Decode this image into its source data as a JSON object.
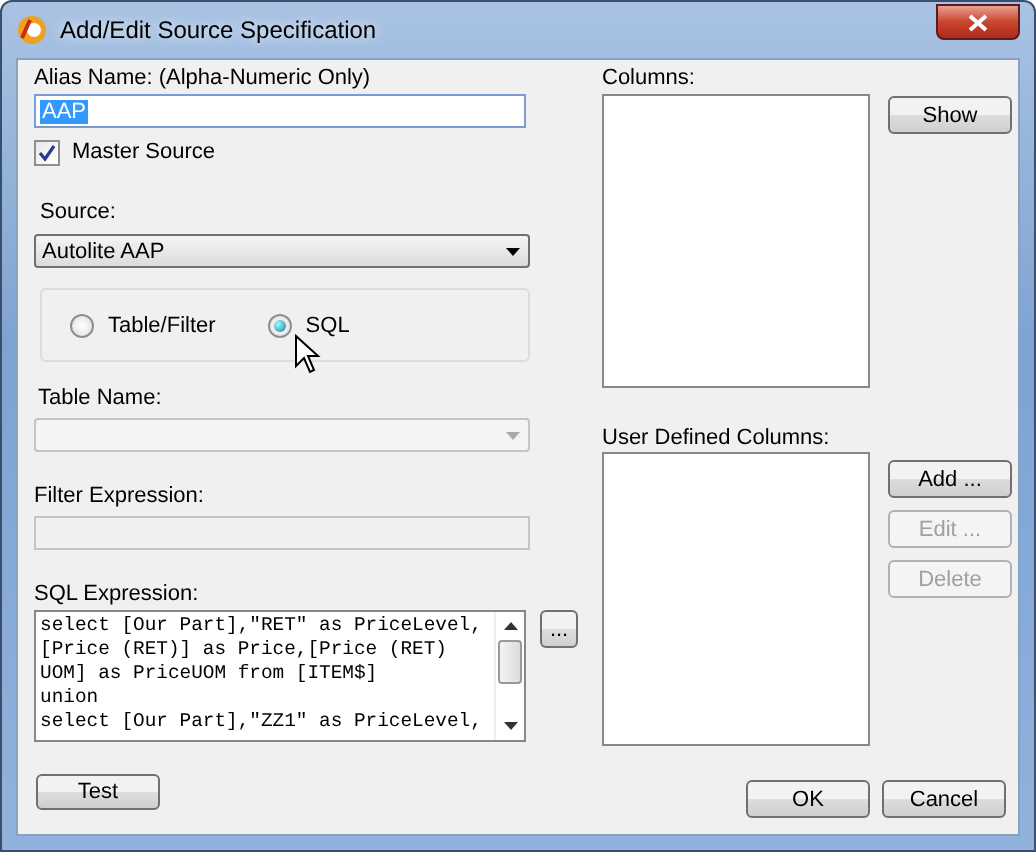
{
  "window": {
    "title": "Add/Edit Source Specification"
  },
  "alias": {
    "label": "Alias Name:  (Alpha-Numeric Only)",
    "value": "AAP",
    "selected": true
  },
  "master_source": {
    "label": "Master Source",
    "checked": true
  },
  "source": {
    "label": "Source:",
    "value": "Autolite AAP"
  },
  "mode_options": [
    {
      "label": "Table/Filter",
      "selected": false
    },
    {
      "label": "SQL",
      "selected": true
    }
  ],
  "table_name": {
    "label": "Table Name:",
    "disabled": true
  },
  "filter_expression": {
    "label": "Filter Expression:",
    "disabled": true
  },
  "sql_expression": {
    "label": "SQL Expression:",
    "lines": [
      "select [Our Part],\"RET\" as PriceLevel,",
      "[Price (RET)] as Price,[Price (RET)",
      "UOM] as PriceUOM from [ITEM$]",
      "union",
      "select [Our Part],\"ZZ1\" as PriceLevel,"
    ]
  },
  "sql_browse_button": "...",
  "columns": {
    "label": "Columns:"
  },
  "show_button": "Show",
  "user_defined_columns": {
    "label": "User Defined Columns:"
  },
  "column_buttons": [
    {
      "label": "Add ...",
      "disabled": false
    },
    {
      "label": "Edit ...",
      "disabled": true
    },
    {
      "label": "Delete",
      "disabled": true
    }
  ],
  "test_button": "Test",
  "dialog_buttons": [
    "OK",
    "Cancel"
  ]
}
